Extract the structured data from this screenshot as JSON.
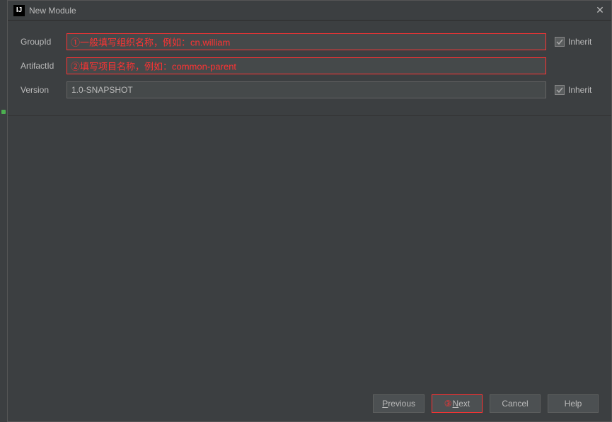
{
  "window": {
    "title": "New Module"
  },
  "form": {
    "groupId": {
      "label": "GroupId",
      "value": "",
      "annotation": "①一般填写组织名称，例如：cn.william",
      "inherit_label": "Inherit"
    },
    "artifactId": {
      "label": "ArtifactId",
      "value": "",
      "annotation": "②填写项目名称，例如：common-parent"
    },
    "version": {
      "label": "Version",
      "value": "1.0-SNAPSHOT",
      "inherit_label": "Inherit"
    }
  },
  "buttons": {
    "previous": "Previous",
    "next": "Next",
    "next_annotation": "③",
    "cancel": "Cancel",
    "help": "Help"
  }
}
